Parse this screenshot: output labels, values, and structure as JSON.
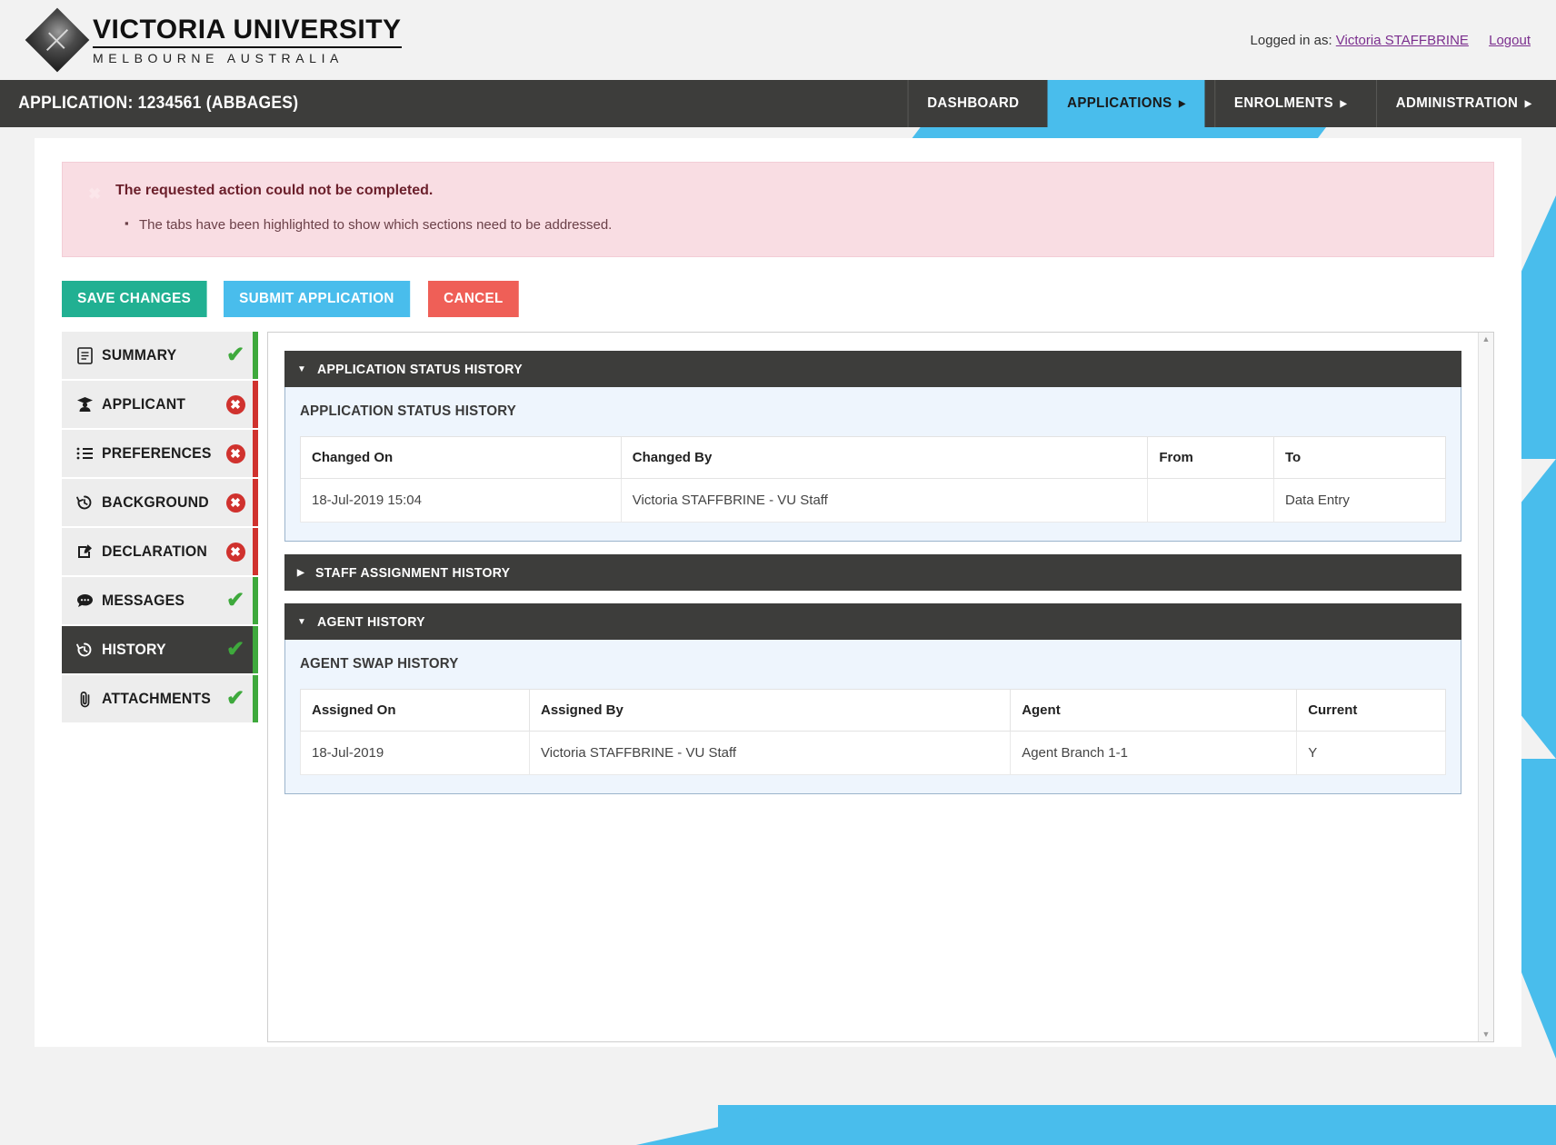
{
  "brand": {
    "name": "VICTORIA UNIVERSITY",
    "tagline": "MELBOURNE AUSTRALIA",
    "logo_icon": "diamond-logo-icon"
  },
  "account": {
    "logged_in_label": "Logged in as:",
    "user_name": "Victoria STAFFBRINE",
    "logout_label": "Logout"
  },
  "navbar": {
    "title": "APPLICATION: 1234561 (ABBAGES)",
    "items": [
      {
        "label": "DASHBOARD",
        "active": false,
        "has_caret": false
      },
      {
        "label": "APPLICATIONS",
        "active": true,
        "has_caret": true,
        "caret": "▶"
      },
      {
        "label": "ENROLMENTS",
        "active": false,
        "has_caret": true,
        "caret": "▶"
      },
      {
        "label": "ADMINISTRATION",
        "active": false,
        "has_caret": true,
        "caret": "▶"
      }
    ],
    "accent_color": "#49bdec",
    "bar_color": "#3d3d3b"
  },
  "alert": {
    "close_icon": "close-icon",
    "close_glyph": "✖",
    "title": "The requested action could not be completed.",
    "items": [
      "The tabs have been highlighted to show which sections need to be addressed."
    ],
    "background_color": "#f9dde3",
    "title_color": "#6b1f2b"
  },
  "actions": [
    {
      "label": "SAVE CHANGES",
      "color": "#21b092",
      "name": "save-changes-button"
    },
    {
      "label": "SUBMIT APPLICATION",
      "color": "#49bdec",
      "name": "submit-application-button"
    },
    {
      "label": "CANCEL",
      "color": "#ef5f57",
      "name": "cancel-button"
    }
  ],
  "sidebar": {
    "items": [
      {
        "label": "SUMMARY",
        "icon": "document-icon",
        "glyph": "὜b",
        "status": "ok",
        "name": "sidebar-item-summary"
      },
      {
        "label": "APPLICANT",
        "icon": "graduate-icon",
        "glyph": "🎓",
        "status": "error",
        "name": "sidebar-item-applicant"
      },
      {
        "label": "PREFERENCES",
        "icon": "list-icon",
        "glyph": "☰",
        "status": "error",
        "name": "sidebar-item-preferences"
      },
      {
        "label": "BACKGROUND",
        "icon": "history-icon",
        "glyph": "↺",
        "status": "error",
        "name": "sidebar-item-background"
      },
      {
        "label": "DECLARATION",
        "icon": "edit-icon",
        "glyph": "✎",
        "status": "error",
        "name": "sidebar-item-declaration"
      },
      {
        "label": "MESSAGES",
        "icon": "comment-icon",
        "glyph": "💬",
        "status": "ok",
        "name": "sidebar-item-messages"
      },
      {
        "label": "HISTORY",
        "icon": "history-icon",
        "glyph": "↺",
        "status": "ok",
        "name": "sidebar-item-history",
        "active": true
      },
      {
        "label": "ATTACHMENTS",
        "icon": "paperclip-icon",
        "glyph": "📎",
        "status": "ok",
        "name": "sidebar-item-attachments"
      }
    ],
    "status_ok_glyph": "✔",
    "status_error_glyph": "✖",
    "ok_color": "#3ea93c",
    "error_color": "#d0322e"
  },
  "panel": {
    "scroll_up_glyph": "▲",
    "scroll_down_glyph": "▼",
    "sections": [
      {
        "name": "application-status-history",
        "header": "APPLICATION STATUS HISTORY",
        "expanded": true,
        "caret": "▼",
        "subtitle": "APPLICATION STATUS HISTORY",
        "columns": [
          "Changed On",
          "Changed By",
          "From",
          "To"
        ],
        "rows": [
          [
            "18-Jul-2019 15:04",
            "Victoria STAFFBRINE - VU Staff",
            "",
            "Data Entry"
          ]
        ]
      },
      {
        "name": "staff-assignment-history",
        "header": "STAFF ASSIGNMENT HISTORY",
        "expanded": false,
        "caret": "▶"
      },
      {
        "name": "agent-history",
        "header": "AGENT HISTORY",
        "expanded": true,
        "caret": "▼",
        "subtitle": "AGENT SWAP HISTORY",
        "columns": [
          "Assigned On",
          "Assigned By",
          "Agent",
          "Current"
        ],
        "rows": [
          [
            "18-Jul-2019",
            "Victoria STAFFBRINE - VU Staff",
            "Agent Branch 1-1",
            "Y"
          ]
        ]
      }
    ]
  }
}
